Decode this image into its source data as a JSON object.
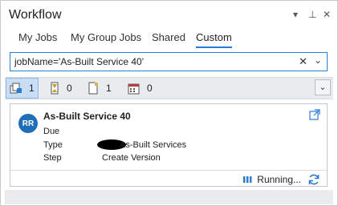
{
  "window": {
    "title": "Workflow",
    "buttons": {
      "menu": "▾",
      "pin": "⊥",
      "close": "✕"
    }
  },
  "tabs": [
    {
      "label": "My Jobs",
      "active": false
    },
    {
      "label": "My Group Jobs",
      "active": false
    },
    {
      "label": "Shared",
      "active": false
    },
    {
      "label": "Custom",
      "active": true
    }
  ],
  "filter": {
    "value": "jobName='As-Built Service 40'"
  },
  "counts": [
    {
      "icon": "job-stack-icon",
      "value": "1",
      "selected": true
    },
    {
      "icon": "hourglass-icon",
      "value": "0",
      "selected": false
    },
    {
      "icon": "document-icon",
      "value": "1",
      "selected": false
    },
    {
      "icon": "calendar-icon",
      "value": "0",
      "selected": false
    }
  ],
  "job": {
    "initials": "RR",
    "name": "As-Built Service 40",
    "fields": {
      "due_label": "Due",
      "type_label": "Type",
      "type_value": "As-Built Services",
      "step_label": "Step",
      "step_value": "Create Version"
    },
    "status": "Running..."
  },
  "colors": {
    "accent": "#2b7bd6",
    "avatar": "#1f6fb8",
    "selected_count_bg": "#c9def5"
  }
}
